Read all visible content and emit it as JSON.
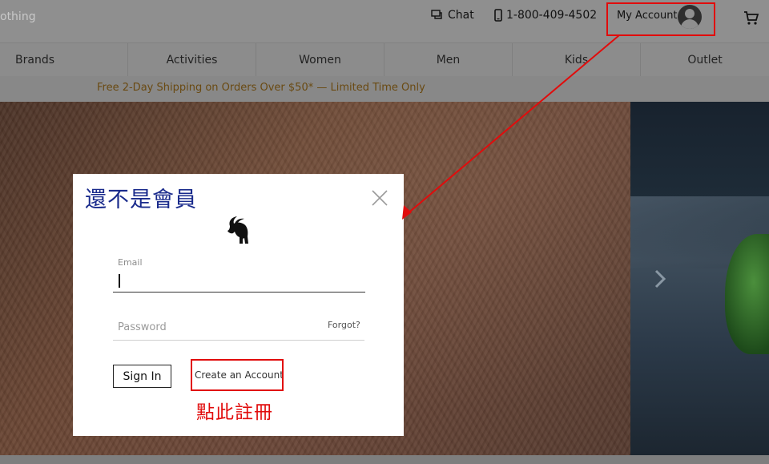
{
  "header": {
    "brand_partial": "othing",
    "chat_label": "Chat",
    "phone": "1-800-409-4502",
    "account_label": "My Account"
  },
  "nav": {
    "items": [
      {
        "label": "Brands"
      },
      {
        "label": "Activities"
      },
      {
        "label": "Women"
      },
      {
        "label": "Men"
      },
      {
        "label": "Kids"
      },
      {
        "label": "Outlet"
      }
    ]
  },
  "promo": {
    "text": "Free 2-Day Shipping on Orders Over $50* — Limited Time Only"
  },
  "modal": {
    "title": "還不是會員",
    "email_label": "Email",
    "email_value": "",
    "password_placeholder": "Password",
    "forgot_label": "Forgot?",
    "signin_label": "Sign In",
    "create_account_label": "Create an Account"
  },
  "annotation": {
    "text": "點此註冊",
    "color": "#e10c0c"
  },
  "colors": {
    "title_blue": "#1a2b8c",
    "promo_text": "#6a4a12",
    "highlight_red": "#e10c0c"
  },
  "icons": [
    "chat-icon",
    "phone-icon",
    "avatar-icon",
    "cart-icon",
    "close-icon",
    "goat-logo-icon",
    "chevron-right-icon"
  ]
}
